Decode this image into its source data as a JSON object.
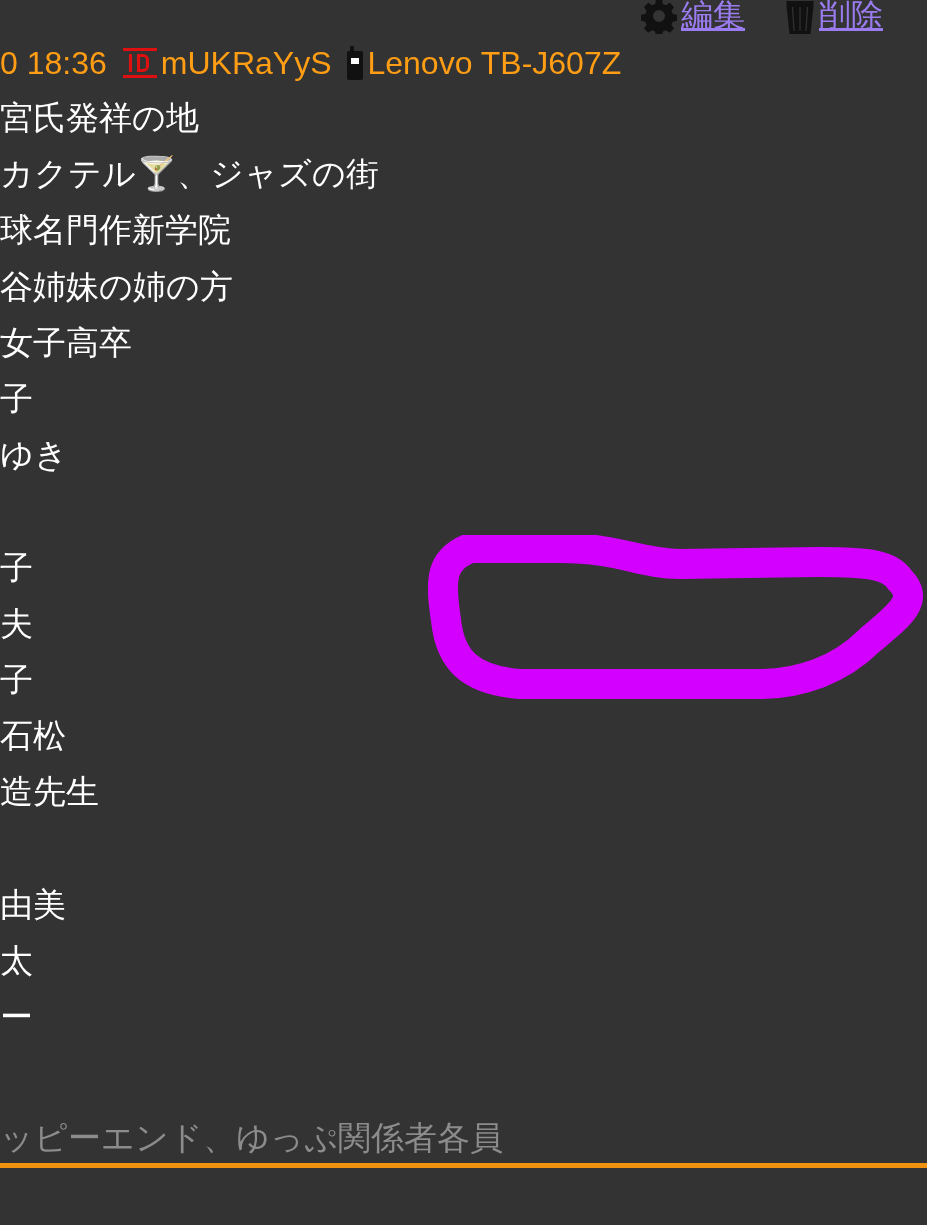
{
  "actions": [
    {
      "kind": "edit",
      "label": "編集"
    },
    {
      "kind": "delete",
      "label": "削除"
    }
  ],
  "meta": {
    "date": "0 18:36",
    "id": "mUKRaYyS",
    "device": "Lenovo TB-J607Z"
  },
  "body_lines": [
    {
      "kind": "text",
      "text": "宮氏発祥の地"
    },
    {
      "kind": "text",
      "text": "カクテル🍸、ジャズの街"
    },
    {
      "kind": "text",
      "text": "球名門作新学院"
    },
    {
      "kind": "text",
      "text": "谷姉妹の姉の方"
    },
    {
      "kind": "text",
      "text": "女子高卒"
    },
    {
      "kind": "text",
      "text": "子"
    },
    {
      "kind": "text",
      "text": "ゆき"
    },
    {
      "kind": "blank"
    },
    {
      "kind": "text",
      "text": "子"
    },
    {
      "kind": "text",
      "text": "夫"
    },
    {
      "kind": "text",
      "text": "子"
    },
    {
      "kind": "text",
      "text": "石松"
    },
    {
      "kind": "text",
      "text": "造先生"
    },
    {
      "kind": "blank"
    },
    {
      "kind": "text",
      "text": "由美"
    },
    {
      "kind": "text",
      "text": "太"
    },
    {
      "kind": "text",
      "text": "ー"
    }
  ],
  "footer_text": "ッピーエンド、ゆっぷ関係者各員"
}
